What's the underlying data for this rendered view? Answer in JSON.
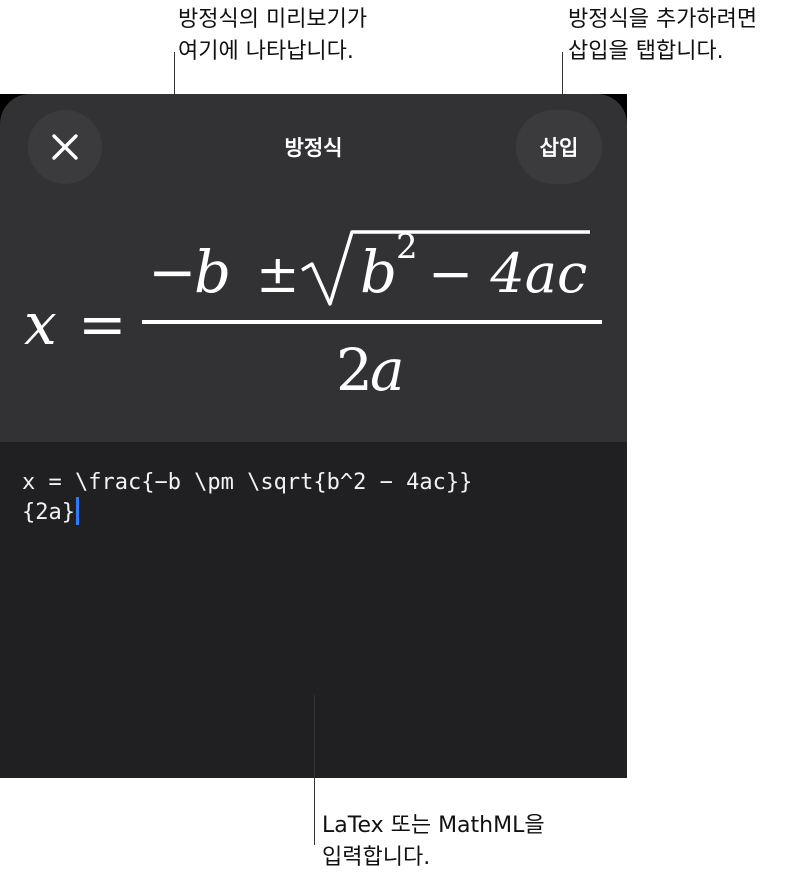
{
  "callouts": {
    "preview": [
      "방정식의 미리보기가",
      "여기에 나타납니다."
    ],
    "insert": [
      "방정식을 추가하려면",
      "삽입을 탭합니다."
    ],
    "input": [
      "LaTex 또는 MathML을",
      "입력합니다."
    ]
  },
  "sheet": {
    "title": "방정식",
    "insert_label": "삽입",
    "close_icon": "close-icon"
  },
  "formula": {
    "lhs": "x",
    "equals": "=",
    "numerator_minus": "−",
    "numerator_b": "b",
    "pm": "±",
    "radicand_b": "b",
    "exponent": "2",
    "radicand_rest": "− 4ac",
    "denominator_2": "2",
    "denominator_a": "a"
  },
  "editor": {
    "line1": "x = \\frac{−b \\pm \\sqrt{b^2 − 4ac}}",
    "line2": "{2a}"
  }
}
